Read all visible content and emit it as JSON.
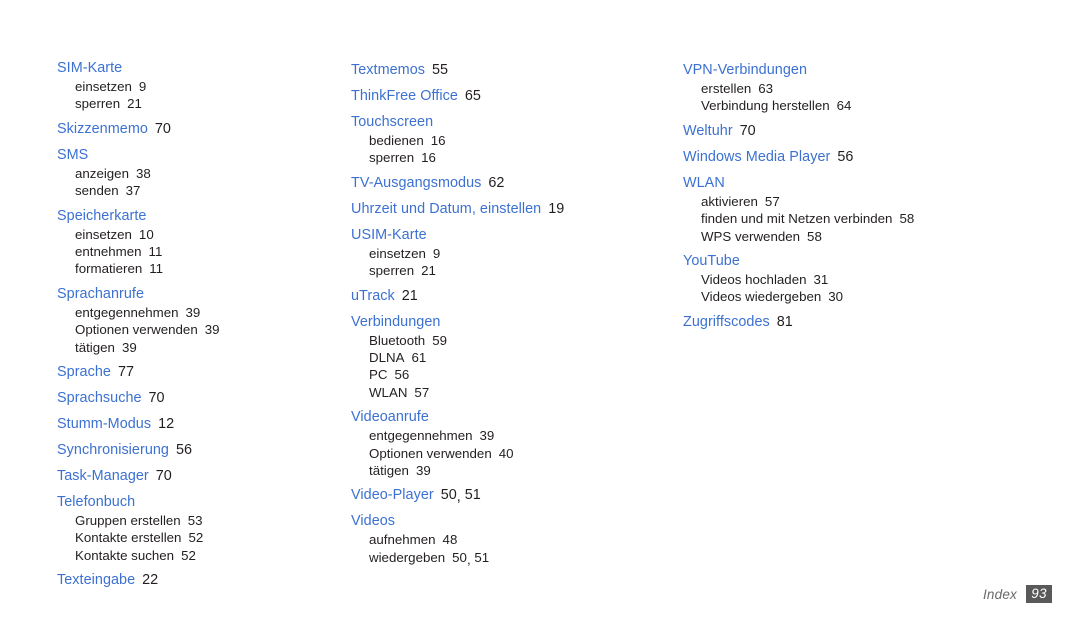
{
  "document": {
    "type": "index-page",
    "language": "de",
    "heading_color": "#3c71d2",
    "text_color": "#231f20",
    "background_color": "#ffffff"
  },
  "columns": [
    {
      "entries": [
        {
          "term": "SIM-Karte",
          "pages": "",
          "subentries": [
            {
              "term": "einsetzen",
              "pages": "9"
            },
            {
              "term": "sperren",
              "pages": "21"
            }
          ]
        },
        {
          "term": "Skizzenmemo",
          "pages": "70",
          "subentries": []
        },
        {
          "term": "SMS",
          "pages": "",
          "subentries": [
            {
              "term": "anzeigen",
              "pages": "38"
            },
            {
              "term": "senden",
              "pages": "37"
            }
          ]
        },
        {
          "term": "Speicherkarte",
          "pages": "",
          "subentries": [
            {
              "term": "einsetzen",
              "pages": "10"
            },
            {
              "term": "entnehmen",
              "pages": "11"
            },
            {
              "term": "formatieren",
              "pages": "11"
            }
          ]
        },
        {
          "term": "Sprachanrufe",
          "pages": "",
          "subentries": [
            {
              "term": "entgegennehmen",
              "pages": "39"
            },
            {
              "term": "Optionen verwenden",
              "pages": "39"
            },
            {
              "term": "tätigen",
              "pages": "39"
            }
          ]
        },
        {
          "term": "Sprache",
          "pages": "77",
          "subentries": []
        },
        {
          "term": "Sprachsuche",
          "pages": "70",
          "subentries": []
        },
        {
          "term": "Stumm-Modus",
          "pages": "12",
          "subentries": []
        },
        {
          "term": "Synchronisierung",
          "pages": "56",
          "subentries": []
        },
        {
          "term": "Task-Manager",
          "pages": "70",
          "subentries": []
        },
        {
          "term": "Telefonbuch",
          "pages": "",
          "subentries": [
            {
              "term": "Gruppen erstellen",
              "pages": "53"
            },
            {
              "term": "Kontakte erstellen",
              "pages": "52"
            },
            {
              "term": "Kontakte suchen",
              "pages": "52"
            }
          ]
        },
        {
          "term": "Texteingabe",
          "pages": "22",
          "subentries": []
        }
      ]
    },
    {
      "entries": [
        {
          "term": "Textmemos",
          "pages": "55",
          "subentries": []
        },
        {
          "term": "ThinkFree Office",
          "pages": "65",
          "subentries": []
        },
        {
          "term": "Touchscreen",
          "pages": "",
          "subentries": [
            {
              "term": "bedienen",
              "pages": "16"
            },
            {
              "term": "sperren",
              "pages": "16"
            }
          ]
        },
        {
          "term": "TV-Ausgangsmodus",
          "pages": "62",
          "subentries": []
        },
        {
          "term": "Uhrzeit und Datum, einstellen",
          "pages": "19",
          "subentries": []
        },
        {
          "term": "USIM-Karte",
          "pages": "",
          "subentries": [
            {
              "term": "einsetzen",
              "pages": "9"
            },
            {
              "term": "sperren",
              "pages": "21"
            }
          ]
        },
        {
          "term": "uTrack",
          "pages": "21",
          "subentries": []
        },
        {
          "term": "Verbindungen",
          "pages": "",
          "subentries": [
            {
              "term": "Bluetooth",
              "pages": "59"
            },
            {
              "term": "DLNA",
              "pages": "61"
            },
            {
              "term": "PC",
              "pages": "56"
            },
            {
              "term": "WLAN",
              "pages": "57"
            }
          ]
        },
        {
          "term": "Videoanrufe",
          "pages": "",
          "subentries": [
            {
              "term": "entgegennehmen",
              "pages": "39"
            },
            {
              "term": "Optionen verwenden",
              "pages": "40"
            },
            {
              "term": "tätigen",
              "pages": "39"
            }
          ]
        },
        {
          "term": "Video-Player",
          "pages": "50, 51",
          "subentries": []
        },
        {
          "term": "Videos",
          "pages": "",
          "subentries": [
            {
              "term": "aufnehmen",
              "pages": "48"
            },
            {
              "term": "wiedergeben",
              "pages": "50, 51"
            }
          ]
        }
      ]
    },
    {
      "entries": [
        {
          "term": "VPN-Verbindungen",
          "pages": "",
          "subentries": [
            {
              "term": "erstellen",
              "pages": "63"
            },
            {
              "term": "Verbindung herstellen",
              "pages": "64"
            }
          ]
        },
        {
          "term": "Weltuhr",
          "pages": "70",
          "subentries": []
        },
        {
          "term": "Windows Media Player",
          "pages": "56",
          "subentries": []
        },
        {
          "term": "WLAN",
          "pages": "",
          "subentries": [
            {
              "term": "aktivieren",
              "pages": "57"
            },
            {
              "term": "finden und mit Netzen verbinden",
              "pages": "58"
            },
            {
              "term": "WPS verwenden",
              "pages": "58"
            }
          ]
        },
        {
          "term": "YouTube",
          "pages": "",
          "subentries": [
            {
              "term": "Videos hochladen",
              "pages": "31"
            },
            {
              "term": "Videos wiedergeben",
              "pages": "30"
            }
          ]
        },
        {
          "term": "Zugriffscodes",
          "pages": "81",
          "subentries": []
        }
      ]
    }
  ],
  "footer": {
    "label": "Index",
    "page_number": "93",
    "badge_color": "#595959",
    "label_color": "#6a6a6a"
  }
}
